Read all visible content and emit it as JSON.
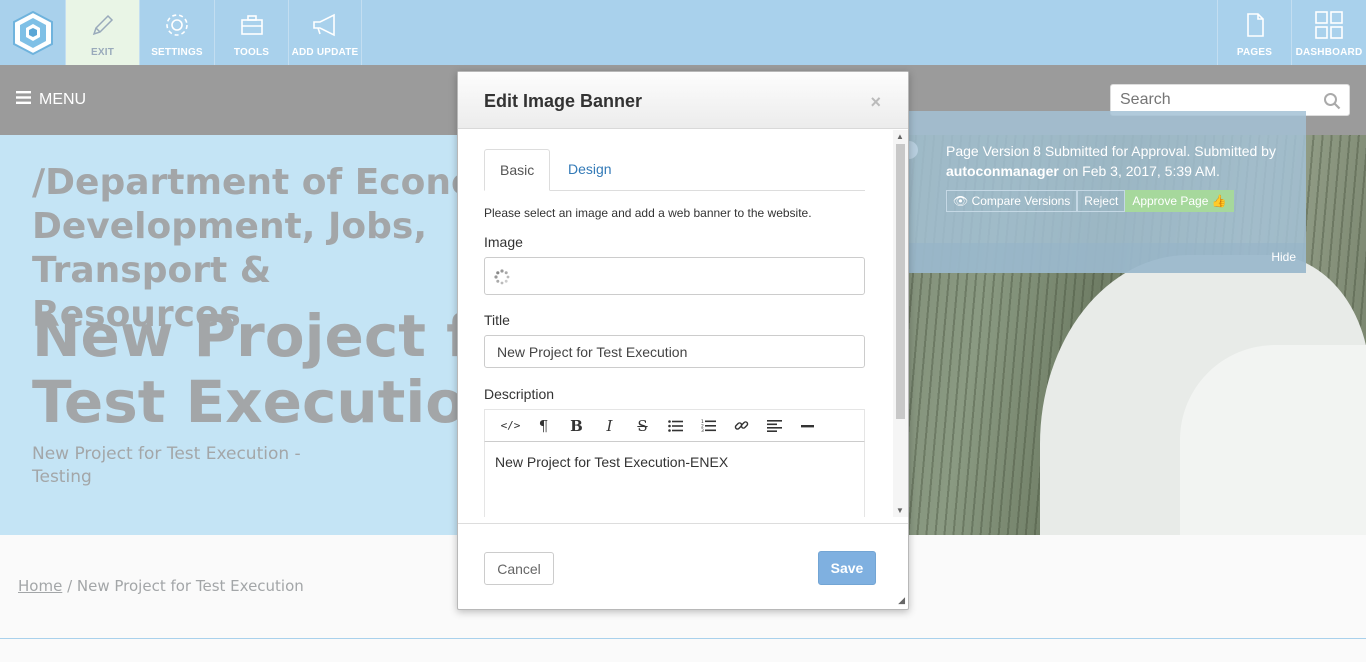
{
  "topbar": {
    "logo": "hexagon-logo-icon",
    "left_buttons": [
      {
        "label": "EXIT",
        "icon": "pencil-icon"
      },
      {
        "label": "SETTINGS",
        "icon": "gear-icon"
      },
      {
        "label": "TOOLS",
        "icon": "toolbox-icon"
      },
      {
        "label": "ADD UPDATE",
        "icon": "megaphone-icon"
      }
    ],
    "right_buttons": [
      {
        "label": "PAGES",
        "icon": "page-icon"
      },
      {
        "label": "DASHBOARD",
        "icon": "dashboard-grid-icon"
      }
    ]
  },
  "menubar": {
    "menu_label": "MENU",
    "search_placeholder": "Search"
  },
  "hero": {
    "department": "/Department of Economic\nDevelopment, Jobs, Transport &\nResources",
    "title": "New Project for Test Execution",
    "subtitle": "New Project for Test Execution - Testing"
  },
  "approval": {
    "message_prefix": "Page Version 8 Submitted for Approval. Submitted by",
    "user": "autoconmanager",
    "message_suffix": "on Feb 3, 2017, 5:39 AM.",
    "compare_label": "Compare Versions",
    "reject_label": "Reject",
    "approve_label": "Approve Page",
    "hide_label": "Hide"
  },
  "breadcrumb": {
    "home": "Home",
    "current": "/ New Project for Test Execution"
  },
  "modal": {
    "title": "Edit Image Banner",
    "close": "×",
    "tabs": [
      {
        "label": "Basic",
        "active": true
      },
      {
        "label": "Design",
        "active": false
      }
    ],
    "help_text": "Please select an image and add a web banner to the website.",
    "image_label": "Image",
    "title_label": "Title",
    "title_value": "New Project for Test Execution",
    "description_label": "Description",
    "toolbar": [
      "code-icon",
      "paragraph-icon",
      "bold-icon",
      "italic-icon",
      "strikethrough-icon",
      "bullet-list-icon",
      "numbered-list-icon",
      "link-icon",
      "align-left-icon",
      "horizontal-rule-icon"
    ],
    "description_value": "New Project for Test Execution-ENEX",
    "cancel_label": "Cancel",
    "save_label": "Save"
  },
  "colors": {
    "topbar": "#a9d1ec",
    "menubar": "#9b9b9b",
    "hero": "#c4e4f5",
    "save": "#7fb0e0",
    "approve": "#a6d89c"
  }
}
